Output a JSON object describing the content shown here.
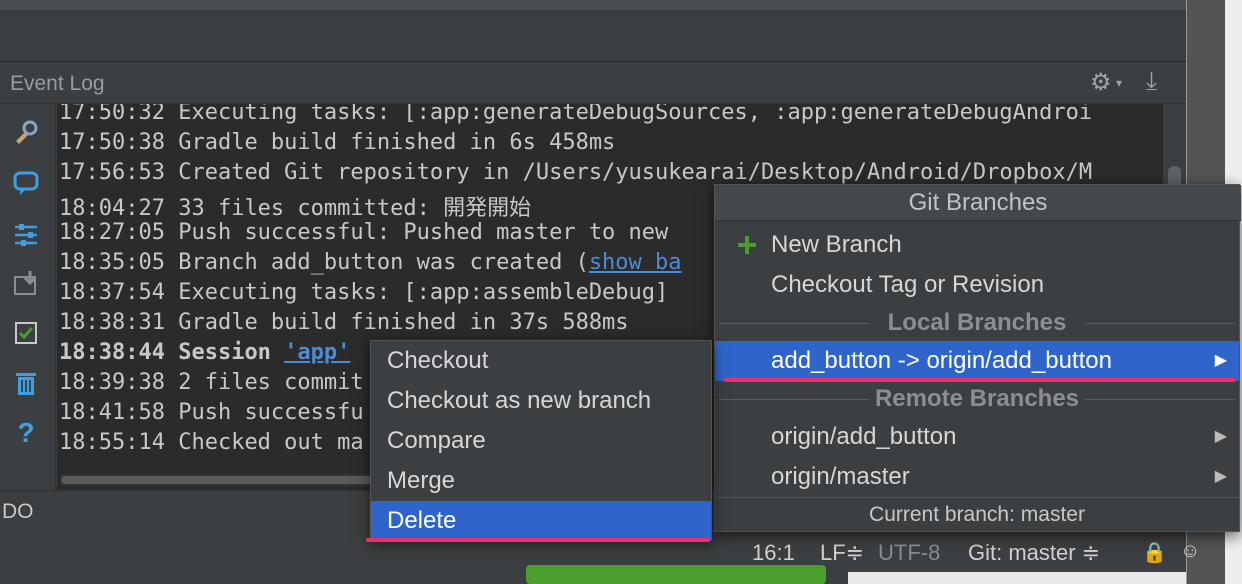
{
  "panel": {
    "title": "Event Log",
    "settings_icon": "gear-icon",
    "download_icon": "download-icon"
  },
  "log": [
    {
      "time": "17:50:32",
      "text": " Executing tasks: [:app:generateDebugSources, :app:generateDebugAndroi"
    },
    {
      "time": "17:50:38",
      "text": " Gradle build finished in 6s 458ms"
    },
    {
      "time": "17:56:53",
      "text": " Created Git repository in /Users/yusukearai/Desktop/Android/Dropbox/M"
    },
    {
      "time": "18:04:27",
      "text": " 33 files committed: 開発開始"
    },
    {
      "time": "18:27:05",
      "text": " Push successful: Pushed master to new"
    },
    {
      "time": "18:35:05",
      "text": " Branch add_button was created (",
      "link": "show ba"
    },
    {
      "time": "18:37:54",
      "text": " Executing tasks: [:app:assembleDebug]"
    },
    {
      "time": "18:38:31",
      "text": " Gradle build finished in 37s 588ms"
    },
    {
      "time": "18:38:44",
      "text": " Session ",
      "link": "'app'",
      "bold": true
    },
    {
      "time": "18:39:38",
      "text": " 2 files commit"
    },
    {
      "time": "18:41:58",
      "text": " Push successfu"
    },
    {
      "time": "18:55:14",
      "text": " Checked out ma"
    }
  ],
  "statusbar": {
    "todo": "DO",
    "position": "16:1",
    "line_sep": "LF≑",
    "encoding": "UTF-8",
    "vcs": "Git: master ≑"
  },
  "git_popup": {
    "title": "Git Branches",
    "new_branch": "New Branch",
    "checkout_tag": "Checkout Tag or Revision",
    "local_header": "Local Branches",
    "local_branches": [
      "add_button -> origin/add_button"
    ],
    "remote_header": "Remote Branches",
    "remote_branches": [
      "origin/add_button",
      "origin/master"
    ],
    "current": "Current branch: master",
    "accent": "#2f65ca",
    "highlight": "#e8316b"
  },
  "context_menu": {
    "items": [
      "Checkout",
      "Checkout as new branch",
      "Compare",
      "Merge",
      "Delete"
    ],
    "selected": "Delete"
  }
}
